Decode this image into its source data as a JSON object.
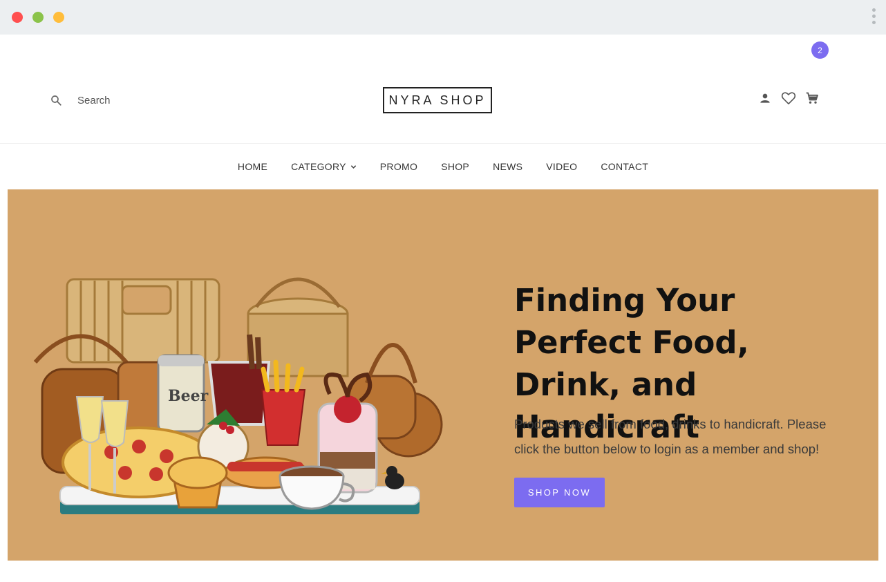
{
  "window": {
    "controls": [
      "close",
      "minimize",
      "maximize"
    ],
    "menu_icon": "kebab-menu-icon"
  },
  "header": {
    "search_placeholder": "Search",
    "logo_text": "NYRA SHOP",
    "icons": [
      "user-icon",
      "heart-icon",
      "cart-icon"
    ],
    "cart_count": "2"
  },
  "nav": {
    "items": [
      {
        "label": "HOME"
      },
      {
        "label": "CATEGORY"
      },
      {
        "label": "PROMO"
      },
      {
        "label": "SHOP"
      },
      {
        "label": "NEWS"
      },
      {
        "label": "VIDEO"
      },
      {
        "label": "CONTACT"
      }
    ]
  },
  "hero": {
    "headline": "Finding Your Perfect Food, Drink, and Handicraft",
    "subtext": "Products we sell from food, drinks to handicraft. Please click the button below to login as a member and shop!",
    "cta_label": "SHOP NOW",
    "background_color": "#d4a46a",
    "cta_color": "#7c6cf0"
  }
}
